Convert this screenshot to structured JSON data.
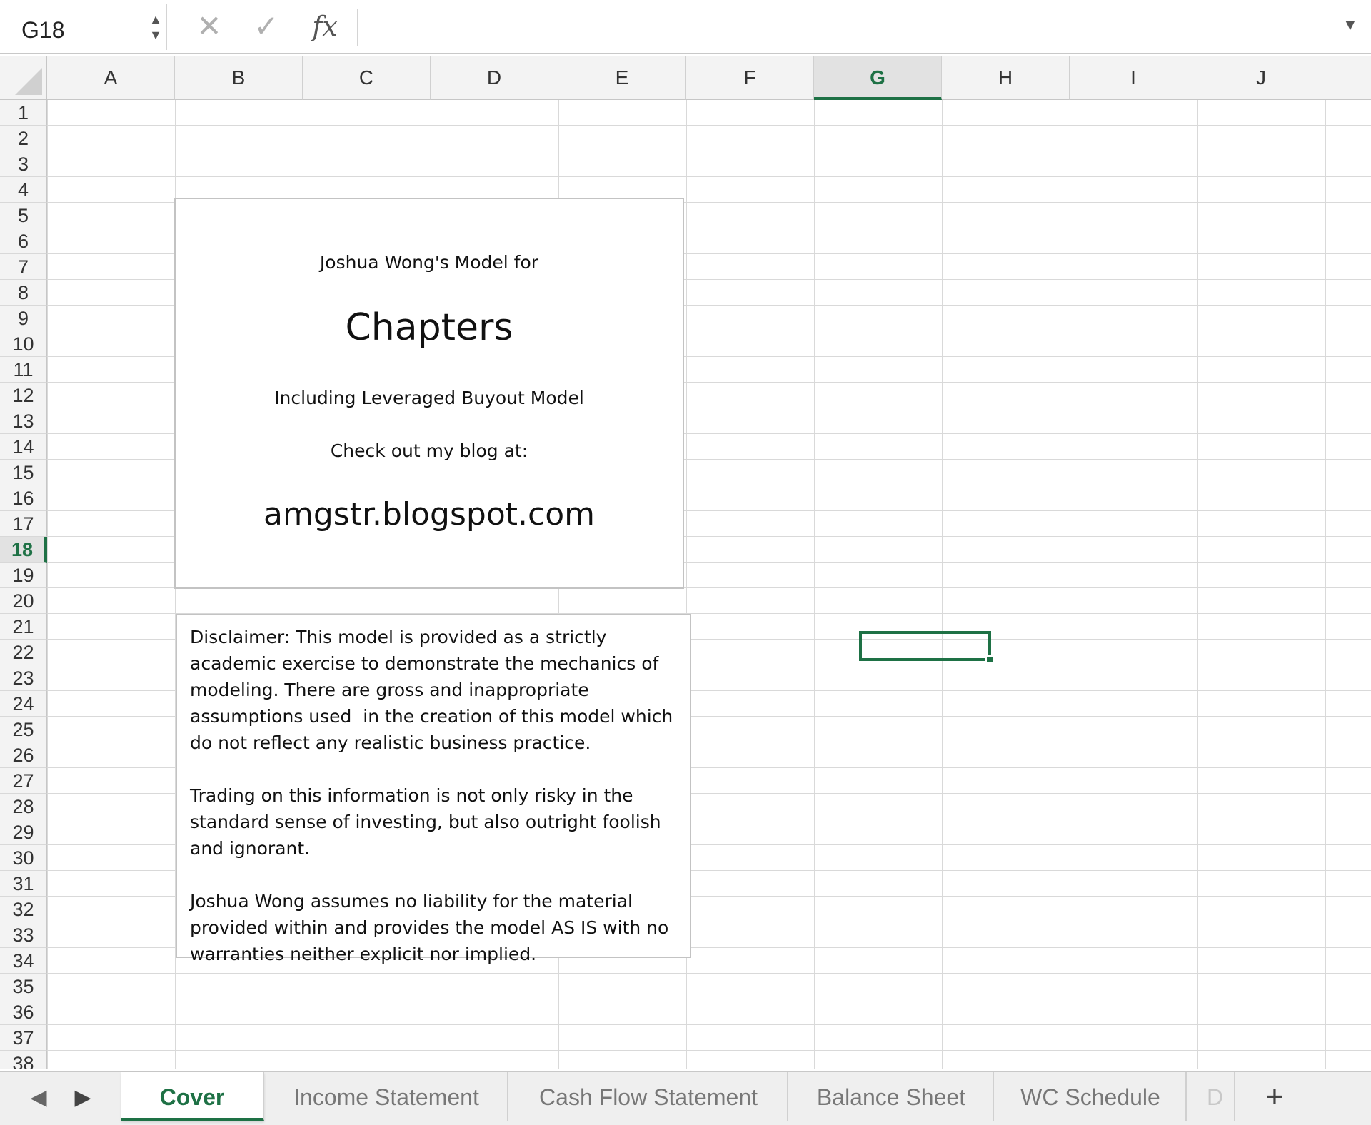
{
  "formula_bar": {
    "name_box": "G18",
    "stepper_icon": "up-down-stepper-icon",
    "cancel_icon": "close-icon",
    "enter_icon": "checkmark-icon",
    "fx_label": "fx",
    "formula_value": "",
    "expand_icon": "chevron-down-icon"
  },
  "grid": {
    "columns": [
      "A",
      "B",
      "C",
      "D",
      "E",
      "F",
      "G",
      "H",
      "I",
      "J"
    ],
    "rows": [
      "1",
      "2",
      "3",
      "4",
      "5",
      "6",
      "7",
      "8",
      "9",
      "10",
      "11",
      "12",
      "13",
      "14",
      "15",
      "16",
      "17",
      "18",
      "19",
      "20",
      "21",
      "22",
      "23",
      "24",
      "25",
      "26",
      "27",
      "28",
      "29",
      "30",
      "31",
      "32",
      "33",
      "34",
      "35",
      "36",
      "37",
      "38"
    ],
    "selected_column": "G",
    "selected_row": "18",
    "accent_color": "#1e7145"
  },
  "cover_box": {
    "intro": "Joshua Wong's Model for",
    "title": "Chapters",
    "subtitle": "Including Leveraged Buyout Model",
    "blog_prompt": "Check out my blog at:",
    "blog_url": "amgstr.blogspot.com"
  },
  "disclaimer_box": {
    "paragraph_1": "Disclaimer: This model is provided as a strictly academic exercise to demonstrate the mechanics of modeling. There are gross and inappropriate assumptions used  in the creation of this model which do not reflect any realistic business practice.",
    "paragraph_2": "Trading on this information is not only risky in the standard sense of investing, but also outright foolish and ignorant.",
    "paragraph_3": "Joshua Wong assumes no liability for the material provided within and provides the model AS IS with no warranties neither explicit nor implied."
  },
  "sheet_tabs": {
    "prev_icon": "triangle-left-icon",
    "next_icon": "triangle-right-icon",
    "tabs": [
      "Cover",
      "Income Statement",
      "Cash Flow Statement",
      "Balance Sheet",
      "WC Schedule",
      "D"
    ],
    "active_tab": "Cover",
    "add_icon": "plus-icon"
  }
}
